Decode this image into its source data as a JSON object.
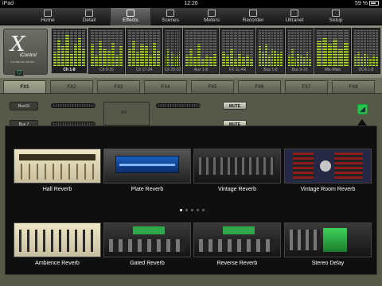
{
  "status": {
    "carrier": "iPad",
    "time": "12:26",
    "battery": "59 %"
  },
  "tabs": [
    {
      "label": "Home",
      "icon": "home-icon"
    },
    {
      "label": "Detail",
      "icon": "detail-icon"
    },
    {
      "label": "Effects",
      "icon": "effects-icon",
      "active": true
    },
    {
      "label": "Scenes",
      "icon": "scenes-icon"
    },
    {
      "label": "Meters",
      "icon": "meters-icon"
    },
    {
      "label": "Recorder",
      "icon": "recorder-icon"
    },
    {
      "label": "Ultranet",
      "icon": "ultranet-icon"
    },
    {
      "label": "Setup",
      "icon": "setup-icon"
    }
  ],
  "logo": {
    "mark": "X",
    "name": "iControl",
    "sub": "X32 BRAND MIXER"
  },
  "meter_groups": [
    {
      "label": "Ch 1-8",
      "active": true,
      "levels": [
        0.4,
        0.75,
        0.55,
        0.9,
        0.35,
        0.6,
        0.8,
        0.5
      ]
    },
    {
      "label": "Ch 9-16",
      "levels": [
        0.6,
        0.3,
        0.7,
        0.5,
        0.45,
        0.65,
        0.3,
        0.55
      ]
    },
    {
      "label": "Ch 17-24",
      "levels": [
        0.5,
        0.7,
        0.4,
        0.6,
        0.55,
        0.3,
        0.65,
        0.45
      ]
    },
    {
      "label": "Ch 25-32",
      "levels": [
        0.3,
        0.5,
        0.2,
        0.4,
        0.35,
        0.25,
        0.3,
        0.4
      ]
    },
    {
      "label": "Aux 1-8",
      "levels": [
        0.3,
        0.5,
        0.25,
        0.6,
        0.2,
        0.3,
        0.25,
        0.35
      ]
    },
    {
      "label": "FX 1L-4R",
      "levels": [
        0.4,
        0.3,
        0.5,
        0.2,
        0.35,
        0.25,
        0.3,
        0.2
      ]
    },
    {
      "label": "Bus 1-8",
      "levels": [
        0.55,
        0.4,
        0.6,
        0.3,
        0.5,
        0.45,
        0.35,
        0.4
      ]
    },
    {
      "label": "Bus 9-16",
      "levels": [
        0.3,
        0.5,
        0.2,
        0.35,
        0.3,
        0.25,
        0.4,
        0.2
      ]
    },
    {
      "label": "Mtx-Main",
      "levels": [
        0.7,
        0.8,
        0.6,
        0.75,
        0.5,
        0.65
      ]
    },
    {
      "label": "DCA 1-8",
      "levels": [
        0.3,
        0.4,
        0.25,
        0.35,
        0.3,
        0.2,
        0.3,
        0.25
      ]
    }
  ],
  "fx_tabs": [
    "FX1",
    "FX2",
    "FX3",
    "FX4",
    "FX5",
    "FX6",
    "FX7",
    "FX8"
  ],
  "panel": {
    "bus1": "Bus10",
    "bus2": "Bus 7",
    "mute1": "MUTE",
    "mute2": "MUTE"
  },
  "effects": [
    {
      "label": "Hall Reverb",
      "style": "t-light"
    },
    {
      "label": "Plate Reverb",
      "style": "t-blue"
    },
    {
      "label": "Vintage Reverb",
      "style": "t-dark"
    },
    {
      "label": "Vintage Room Reverb",
      "style": "t-vroom"
    },
    {
      "label": "Ambience Reverb",
      "style": "t-amb"
    },
    {
      "label": "Gated Reverb",
      "style": "t-gate"
    },
    {
      "label": "Reverse Reverb",
      "style": "t-gate"
    },
    {
      "label": "Stereo Delay",
      "style": "t-stereo"
    }
  ],
  "pager": {
    "pages": 5,
    "current": 1
  }
}
